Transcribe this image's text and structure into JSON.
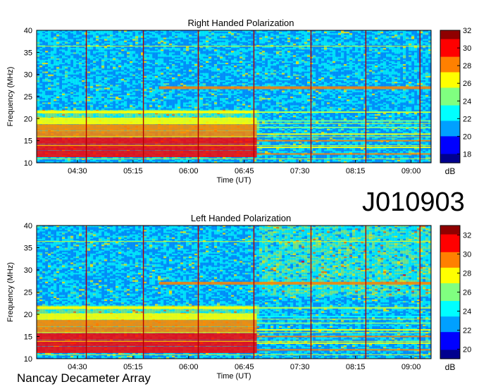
{
  "observation_id": "J010903",
  "observatory": "Nancay Decameter Array",
  "colormap": [
    "#00008f",
    "#0000ff",
    "#00a0ff",
    "#00ffff",
    "#80ff80",
    "#ffff00",
    "#ff8000",
    "#ff0000",
    "#8f0000"
  ],
  "chart_data": [
    {
      "type": "heatmap",
      "title": "Right Handed Polarization",
      "xlabel": "Time (UT)",
      "ylabel": "Frequency (MHz)",
      "x_ticks": [
        "04:30",
        "05:15",
        "06:00",
        "06:45",
        "07:30",
        "08:15",
        "09:00"
      ],
      "x_tick_hours": [
        4.5,
        5.25,
        6.0,
        6.75,
        7.5,
        8.25,
        9.0
      ],
      "xlim_hours": [
        3.95,
        9.27
      ],
      "ylim": [
        10,
        40
      ],
      "y_ticks": [
        10,
        15,
        20,
        25,
        30,
        35,
        40
      ],
      "colorbar_label": "dB",
      "colorbar_ticks": [
        18,
        20,
        22,
        24,
        26,
        28,
        30,
        32
      ],
      "colorbar_range": [
        17,
        32
      ],
      "vertical_lines_hours": [
        4.62,
        5.39,
        6.13,
        6.88,
        7.65,
        8.39,
        9.12
      ],
      "emission_bands": [
        {
          "freq_mhz": 12.0,
          "intensity_db": 31
        },
        {
          "freq_mhz": 13.5,
          "intensity_db": 30
        },
        {
          "freq_mhz": 15.0,
          "intensity_db": 31
        },
        {
          "freq_mhz": 16.5,
          "intensity_db": 29
        },
        {
          "freq_mhz": 18.0,
          "intensity_db": 28
        },
        {
          "freq_mhz": 19.5,
          "intensity_db": 26
        },
        {
          "freq_mhz": 21.5,
          "intensity_db": 27
        },
        {
          "freq_mhz": 27.0,
          "intensity_db": 29
        }
      ],
      "grid": false
    },
    {
      "type": "heatmap",
      "title": "Left Handed Polarization",
      "xlabel": "Time (UT)",
      "ylabel": "Frequency (MHz)",
      "x_ticks": [
        "04:30",
        "05:15",
        "06:00",
        "06:45",
        "07:30",
        "08:15",
        "09:00"
      ],
      "x_tick_hours": [
        4.5,
        5.25,
        6.0,
        6.75,
        7.5,
        8.25,
        9.0
      ],
      "xlim_hours": [
        3.95,
        9.27
      ],
      "ylim": [
        10,
        40
      ],
      "y_ticks": [
        10,
        15,
        20,
        25,
        30,
        35,
        40
      ],
      "colorbar_label": "dB",
      "colorbar_ticks": [
        20,
        22,
        24,
        26,
        28,
        30,
        32
      ],
      "colorbar_range": [
        19,
        33
      ],
      "vertical_lines_hours": [
        4.62,
        5.39,
        6.13,
        6.88,
        7.65,
        8.39,
        9.12
      ],
      "emission_bands": [
        {
          "freq_mhz": 12.0,
          "intensity_db": 32
        },
        {
          "freq_mhz": 13.5,
          "intensity_db": 31
        },
        {
          "freq_mhz": 15.0,
          "intensity_db": 32
        },
        {
          "freq_mhz": 16.5,
          "intensity_db": 30
        },
        {
          "freq_mhz": 18.0,
          "intensity_db": 29
        },
        {
          "freq_mhz": 19.5,
          "intensity_db": 27
        },
        {
          "freq_mhz": 21.5,
          "intensity_db": 28
        },
        {
          "freq_mhz": 27.0,
          "intensity_db": 29
        }
      ],
      "grid": false
    }
  ]
}
